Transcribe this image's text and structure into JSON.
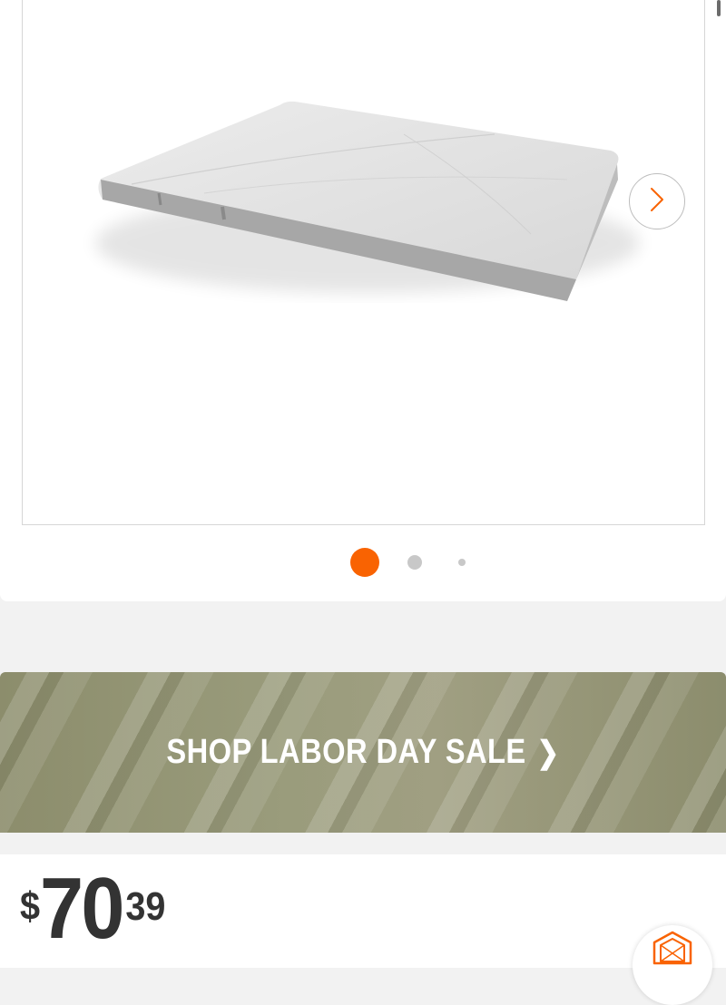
{
  "product": {
    "image": {
      "name": "marble-pastry-board",
      "alt": ""
    },
    "carousel": {
      "total_slides": 3,
      "active_slide": 1,
      "next_icon": "chevron-right-icon"
    }
  },
  "promo_banner": {
    "label": "SHOP LABOR DAY SALE",
    "chevron": "❯"
  },
  "price": {
    "currency": "$",
    "dollars": "70",
    "cents": "39"
  },
  "assistant_button": {
    "icon": "hexagon-logo-icon"
  },
  "colors": {
    "accent": "#f96302",
    "price_text": "#333333",
    "banner_bg": "#979777"
  }
}
